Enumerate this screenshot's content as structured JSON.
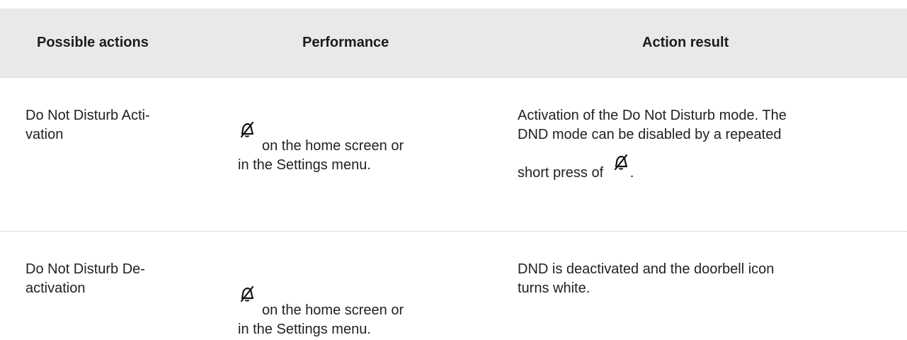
{
  "table": {
    "headers": {
      "actions": "Possible actions",
      "performance": "Performance",
      "result": "Action result"
    },
    "rows": [
      {
        "action_line1": "Do Not Disturb Acti-",
        "action_line2": "vation",
        "performance_line1": "on the home screen or",
        "performance_line2": "in the Settings menu.",
        "result_line1": "Activation of the Do Not Disturb mode. The",
        "result_line2": "DND mode can be disabled by a repeated",
        "result_line3_pre": "short press of",
        "result_line3_post": "."
      },
      {
        "action_line1": "Do Not Disturb De-",
        "action_line2": "activation",
        "performance_line1": "on the home screen or",
        "performance_line2": "in the Settings menu.",
        "result_line1": "DND is deactivated and the doorbell icon",
        "result_line2": "turns white."
      }
    ]
  },
  "icons": {
    "dnd": "bell-off-icon"
  },
  "colors": {
    "header_background": "#e9e9e9",
    "text": "#222222",
    "separator": "#bdbdbd"
  }
}
